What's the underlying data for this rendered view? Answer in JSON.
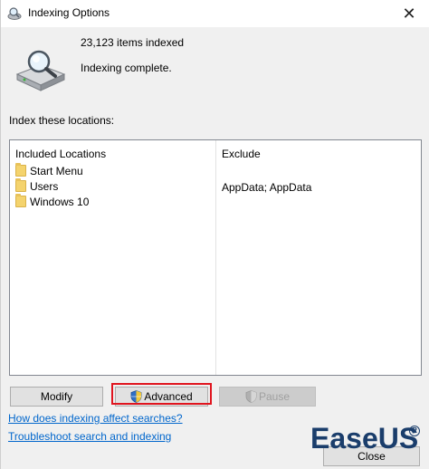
{
  "window": {
    "title": "Indexing Options",
    "close_glyph": "✕",
    "icon": "indexing-options-icon"
  },
  "status": {
    "items_indexed": "23,123 items indexed",
    "message": "Indexing complete.",
    "icon": "drive-search-icon"
  },
  "locations": {
    "section_label": "Index these locations:",
    "header_included": "Included Locations",
    "header_exclude": "Exclude",
    "rows": [
      {
        "label": "Start Menu",
        "exclude": ""
      },
      {
        "label": "Users",
        "exclude": "AppData; AppData"
      },
      {
        "label": "Windows 10",
        "exclude": ""
      }
    ]
  },
  "buttons": {
    "modify": "Modify",
    "advanced": "Advanced",
    "pause": "Pause",
    "close": "Close"
  },
  "links": {
    "how_indexing": "How does indexing affect searches?",
    "troubleshoot": "Troubleshoot search and indexing"
  },
  "brand": {
    "name": "EaseUS",
    "registered": "R",
    "color": "#1a3d6b"
  },
  "highlight_color": "#e0141e"
}
